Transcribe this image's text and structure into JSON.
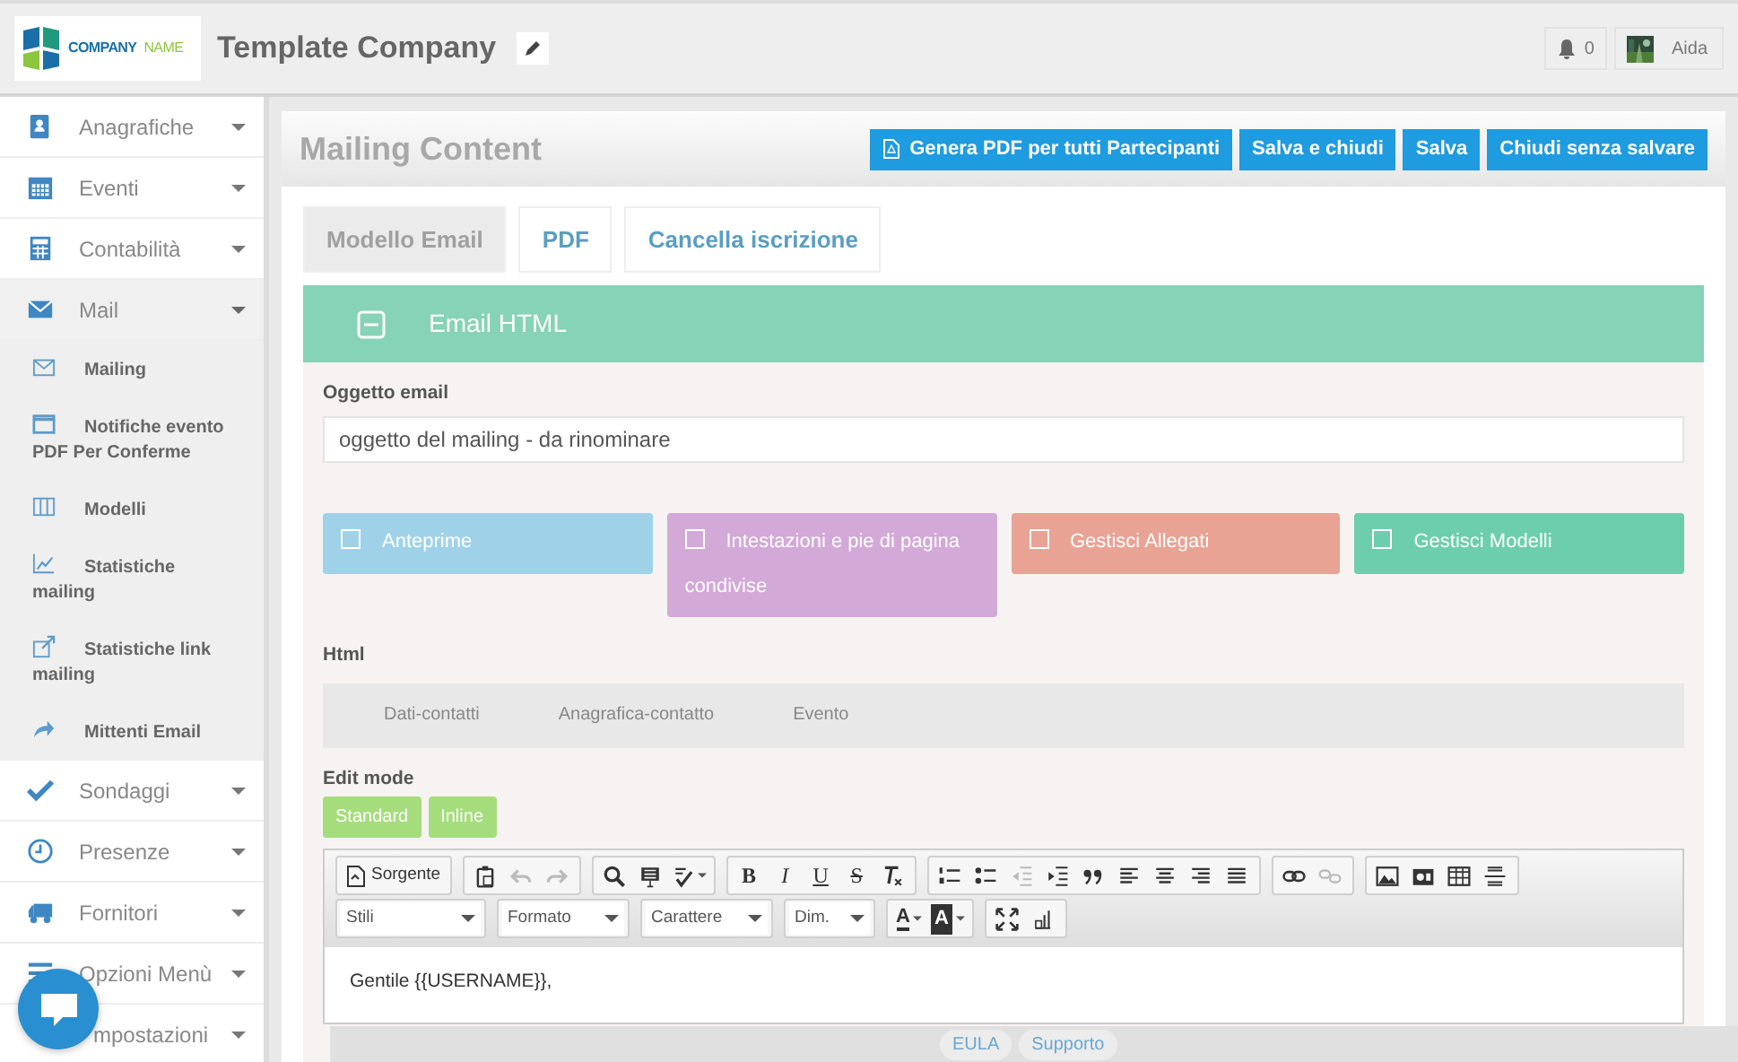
{
  "header": {
    "logo": {
      "words": [
        "COMPANY",
        "NAME"
      ]
    },
    "title": "Template Company",
    "notifications": "0",
    "user": "Aida"
  },
  "sidebar": {
    "items": [
      {
        "label": "Anagrafiche",
        "expanded": false
      },
      {
        "label": "Eventi",
        "expanded": false
      },
      {
        "label": "Contabilità",
        "expanded": false
      },
      {
        "label": "Mail",
        "expanded": true,
        "children": [
          {
            "label": "Mailing"
          },
          {
            "label": "Notifiche evento PDF Per Conferme"
          },
          {
            "label": "Modelli"
          },
          {
            "label": "Statistiche mailing"
          },
          {
            "label": "Statistiche link mailing"
          },
          {
            "label": "Mittenti Email"
          }
        ]
      },
      {
        "label": "Sondaggi",
        "expanded": false
      },
      {
        "label": "Presenze",
        "expanded": false
      },
      {
        "label": "Fornitori",
        "expanded": false
      },
      {
        "label": "Opzioni Menù",
        "expanded": false
      },
      {
        "label": "mpostazioni",
        "expanded": false
      }
    ]
  },
  "panel": {
    "title": "Mailing Content",
    "buttons": [
      {
        "label": "Genera PDF per tutti Partecipanti",
        "kind": "pdf"
      },
      {
        "label": "Salva e chiudi",
        "kind": "plain"
      },
      {
        "label": "Salva",
        "kind": "plain"
      },
      {
        "label": "Chiudi senza salvare",
        "kind": "plain"
      }
    ],
    "tabs": [
      {
        "label": "Modello Email",
        "selected": true
      },
      {
        "label": "PDF",
        "selected": false
      },
      {
        "label": "Cancella iscrizione",
        "selected": false
      }
    ],
    "section": {
      "title": "Email HTML",
      "expanded": true
    },
    "subject": {
      "label": "Oggetto email",
      "value": "oggetto del mailing - da rinominare"
    },
    "options": [
      {
        "label": "Anteprime",
        "color": "#9fd2e9",
        "checked": false
      },
      {
        "label": "Intestazioni e pie di pagina condivise",
        "color": "#d3a9d8",
        "checked": false
      },
      {
        "label": "Gestisci Allegati",
        "color": "#e9a394",
        "checked": false
      },
      {
        "label": "Gestisci Modelli",
        "color": "#6dcead",
        "checked": false
      }
    ],
    "html": {
      "label": "Html",
      "tabs": [
        "Dati-contatti",
        "Anagrafica-contatto",
        "Evento"
      ]
    },
    "edit_mode": {
      "label": "Edit mode",
      "buttons": [
        "Standard",
        "Inline"
      ]
    },
    "toolbar": {
      "rows": [
        [
          [
            {
              "kind": "source",
              "text": "Sorgente",
              "disabled": false
            }
          ],
          [
            {
              "kind": "icon",
              "disabled": false
            },
            {
              "kind": "icon",
              "disabled": true
            },
            {
              "kind": "icon",
              "disabled": true
            }
          ],
          [
            {
              "kind": "icon",
              "disabled": false
            },
            {
              "kind": "icon",
              "disabled": false
            },
            {
              "kind": "icon",
              "disabled": false
            }
          ],
          [
            {
              "kind": "bold",
              "text": "B",
              "disabled": false
            },
            {
              "kind": "italic",
              "text": "I",
              "disabled": false
            },
            {
              "kind": "underline",
              "text": "U",
              "disabled": false
            },
            {
              "kind": "strike",
              "text": "S",
              "disabled": false
            },
            {
              "kind": "icon",
              "disabled": false
            }
          ],
          [
            {
              "kind": "icon",
              "disabled": false
            },
            {
              "kind": "icon",
              "disabled": false
            },
            {
              "kind": "icon",
              "disabled": true
            },
            {
              "kind": "icon",
              "disabled": false
            },
            {
              "kind": "icon",
              "disabled": false
            },
            {
              "kind": "icon",
              "disabled": false
            },
            {
              "kind": "icon",
              "disabled": false
            },
            {
              "kind": "icon",
              "disabled": false
            },
            {
              "kind": "icon",
              "disabled": false
            }
          ],
          [
            {
              "kind": "icon",
              "disabled": false
            },
            {
              "kind": "icon",
              "disabled": true
            }
          ],
          [
            {
              "kind": "icon",
              "disabled": false
            },
            {
              "kind": "icon",
              "disabled": false
            },
            {
              "kind": "icon",
              "disabled": false
            },
            {
              "kind": "icon",
              "disabled": false
            }
          ]
        ],
        [
          [
            {
              "kind": "combo",
              "text": "Stili",
              "disabled": false
            }
          ],
          [
            {
              "kind": "combo",
              "text": "Formato",
              "disabled": false
            }
          ],
          [
            {
              "kind": "combo",
              "text": "Carattere",
              "disabled": false
            }
          ],
          [
            {
              "kind": "combo",
              "text": "Dim.",
              "disabled": false
            }
          ],
          [
            {
              "kind": "textcolor",
              "text": "A",
              "disabled": false
            },
            {
              "kind": "bgcolor",
              "text": "A",
              "disabled": false
            }
          ],
          [
            {
              "kind": "icon",
              "disabled": false
            },
            {
              "kind": "icon",
              "disabled": false
            }
          ]
        ]
      ]
    },
    "editor_text": "Gentile {{USERNAME}},"
  },
  "footer": {
    "links": [
      "EULA",
      "Supporto"
    ]
  }
}
